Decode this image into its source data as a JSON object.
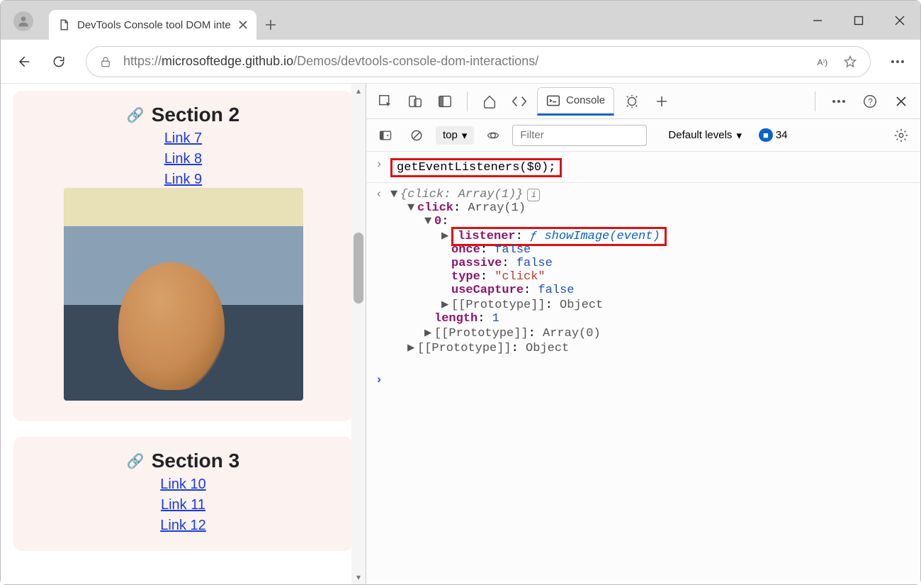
{
  "window": {
    "tab_title": "DevTools Console tool DOM inte"
  },
  "toolbar": {
    "url_host": "microsoftedge.github.io",
    "url_path": "/Demos/devtools-console-dom-interactions/",
    "url_scheme": "https://"
  },
  "page": {
    "sections": [
      {
        "title": "Section 2",
        "links": [
          "Link 7",
          "Link 8",
          "Link 9"
        ],
        "has_image": true
      },
      {
        "title": "Section 3",
        "links": [
          "Link 10",
          "Link 11",
          "Link 12"
        ],
        "has_image": false
      }
    ]
  },
  "devtools": {
    "tabs": {
      "console": "Console"
    },
    "context": "top",
    "filter_placeholder": "Filter",
    "levels_label": "Default levels",
    "issues_count": "34",
    "input": "getEventListeners($0);",
    "output": {
      "summary_key": "click",
      "summary_val": "Array(1)",
      "click_label": "click",
      "click_val": "Array(1)",
      "index": "0",
      "listener_key": "listener",
      "listener_fn": "showImage(event)",
      "props": [
        {
          "k": "once",
          "v": "false",
          "t": "num"
        },
        {
          "k": "passive",
          "v": "false",
          "t": "num"
        },
        {
          "k": "type",
          "v": "\"click\"",
          "t": "str"
        },
        {
          "k": "useCapture",
          "v": "false",
          "t": "num"
        }
      ],
      "proto_obj": "Object",
      "length_key": "length",
      "length_val": "1",
      "proto_arr": "Array(0)",
      "proto_obj2": "Object"
    }
  }
}
